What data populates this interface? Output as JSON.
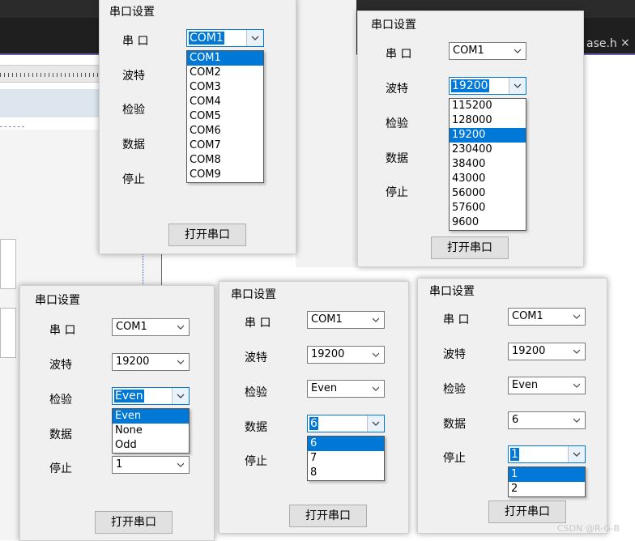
{
  "background": {
    "file_tab": "ase.h",
    "close_glyph": "×"
  },
  "watermark": "CSDN @R-G-B",
  "panels": [
    {
      "title": "串口设置",
      "labels": [
        "串  口",
        "波特",
        "检验",
        "数据",
        "停止"
      ],
      "combos": [
        {
          "value": "COM1",
          "open": true
        }
      ],
      "dropdown": {
        "options": [
          "COM1",
          "COM2",
          "COM3",
          "COM4",
          "COM5",
          "COM6",
          "COM7",
          "COM8",
          "COM9"
        ],
        "highlight": 0
      },
      "button": "打开串口"
    },
    {
      "title": "串口设置",
      "labels": [
        "串  口",
        "波特",
        "检验",
        "数据",
        "停止"
      ],
      "combos": [
        {
          "value": "COM1"
        },
        {
          "value": "19200",
          "open": true
        }
      ],
      "dropdown": {
        "options": [
          "115200",
          "128000",
          "19200",
          "230400",
          "38400",
          "43000",
          "56000",
          "57600",
          "9600"
        ],
        "highlight": 2
      },
      "button": "打开串口"
    },
    {
      "title": "串口设置",
      "labels": [
        "串  口",
        "波特",
        "检验",
        "数据",
        "停止"
      ],
      "combos": [
        {
          "value": "COM1"
        },
        {
          "value": "19200"
        },
        {
          "value": "Even",
          "open": true
        },
        {
          "value": ""
        },
        {
          "value": "1"
        }
      ],
      "dropdown": {
        "options": [
          "Even",
          "None",
          "Odd"
        ],
        "highlight": 0
      },
      "button": "打开串口"
    },
    {
      "title": "串口设置",
      "labels": [
        "串  口",
        "波特",
        "检验",
        "数据",
        "停止"
      ],
      "combos": [
        {
          "value": "COM1"
        },
        {
          "value": "19200"
        },
        {
          "value": "Even"
        },
        {
          "value": "6",
          "open": true
        }
      ],
      "dropdown": {
        "options": [
          "6",
          "7",
          "8"
        ],
        "highlight": 0
      },
      "button": "打开串口"
    },
    {
      "title": "串口设置",
      "labels": [
        "串  口",
        "波特",
        "检验",
        "数据",
        "停止"
      ],
      "combos": [
        {
          "value": "COM1"
        },
        {
          "value": "19200"
        },
        {
          "value": "Even"
        },
        {
          "value": "6"
        },
        {
          "value": "1",
          "open": true
        }
      ],
      "dropdown": {
        "options": [
          "1",
          "2"
        ],
        "highlight": 0
      },
      "button": "打开串口"
    }
  ]
}
